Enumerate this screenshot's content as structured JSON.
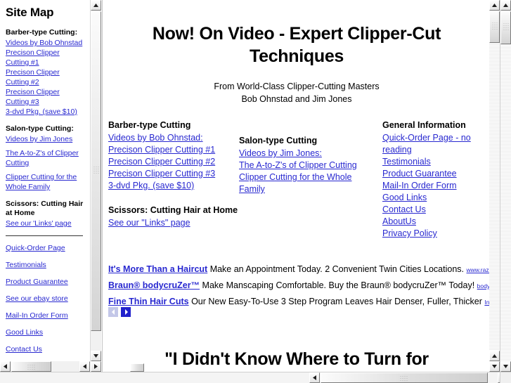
{
  "sidebar": {
    "title": "Site Map",
    "sections": [
      {
        "heading": "Barber-type Cutting:",
        "links": [
          "Videos by Bob Ohnstad",
          "Precison Clipper Cutting #1",
          "Precison Clipper Cutting #2",
          "Precison Clipper Cutting #3",
          "3-dvd Pkg. (save $10)"
        ]
      },
      {
        "heading": "Salon-type Cutting:",
        "links": [
          "Videos by Jim Jones",
          "The A-to-Z's of Clipper Cutting",
          "Clipper Cutting for the Whole Family"
        ]
      },
      {
        "heading": "Scissors: Cutting Hair at Home",
        "links": [
          "See our 'Links' page"
        ]
      }
    ],
    "footer_links": [
      "Quick-Order Page",
      "Testimonials",
      "Product Guarantee",
      "See our ebay store",
      "Mail-In Order Form",
      "Good Links",
      "Contact Us"
    ]
  },
  "main": {
    "hero": {
      "title": "Now! On Video - Expert Clipper-Cut Techniques",
      "subtitle_line1": "From World-Class Clipper-Cutting Masters",
      "subtitle_line2": "Bob Ohnstad and Jim Jones"
    },
    "columns": [
      {
        "heading": "Barber-type Cutting",
        "links": [
          "Videos by Bob Ohnstad:",
          "Precison Clipper Cutting #1",
          "Precison Clipper Cutting #2",
          "Precison Clipper Cutting #3",
          "3-dvd Pkg. (save $10)"
        ],
        "sub_heading": "Scissors: Cutting Hair at Home",
        "sub_links": [
          "See our \"Links\" page"
        ]
      },
      {
        "heading": "Salon-type Cutting",
        "links": [
          "Videos by Jim Jones:",
          "The A-to-Z's of Clipper Cutting",
          "Clipper Cutting for the Whole Family"
        ],
        "sub_heading": "",
        "sub_links": []
      },
      {
        "heading": "General Information",
        "links": [
          "Quick-Order Page - no reading",
          "Testimonials",
          "Product Guarantee",
          "Mail-In Order Form",
          "Good Links",
          "Contact Us",
          "AboutUs",
          "Privacy Policy"
        ],
        "sub_heading": "",
        "sub_links": []
      }
    ],
    "promos": [
      {
        "title": "It's More Than a Haircut",
        "text": "Make an Appointment Today. 2 Convenient Twin Cities Locations.",
        "url": "www.razeformer"
      },
      {
        "title": "Braun® bodycruZer™",
        "text": "Make Manscaping Comfortable. Buy the Braun® bodycruZer™ Today!",
        "url": "bodycruZer.B"
      },
      {
        "title": "Fine Thin Hair Cuts",
        "text": "Our New Easy-To-Use 3 Step Program Leaves Hair Denser, Fuller, Thicker",
        "url": "Intraforce.c"
      }
    ],
    "promo_nav": {
      "prev_label": "‹",
      "next_label": "›"
    },
    "bottom_heading": "\"I Didn't Know Where to Turn for"
  },
  "colors": {
    "link": "#2828d0",
    "text": "#000000",
    "page_background": "#ffffff",
    "nav_active": "#2222cc",
    "nav_disabled": "#c3c7e8",
    "scrollbar_track": "#f1f1f1"
  }
}
